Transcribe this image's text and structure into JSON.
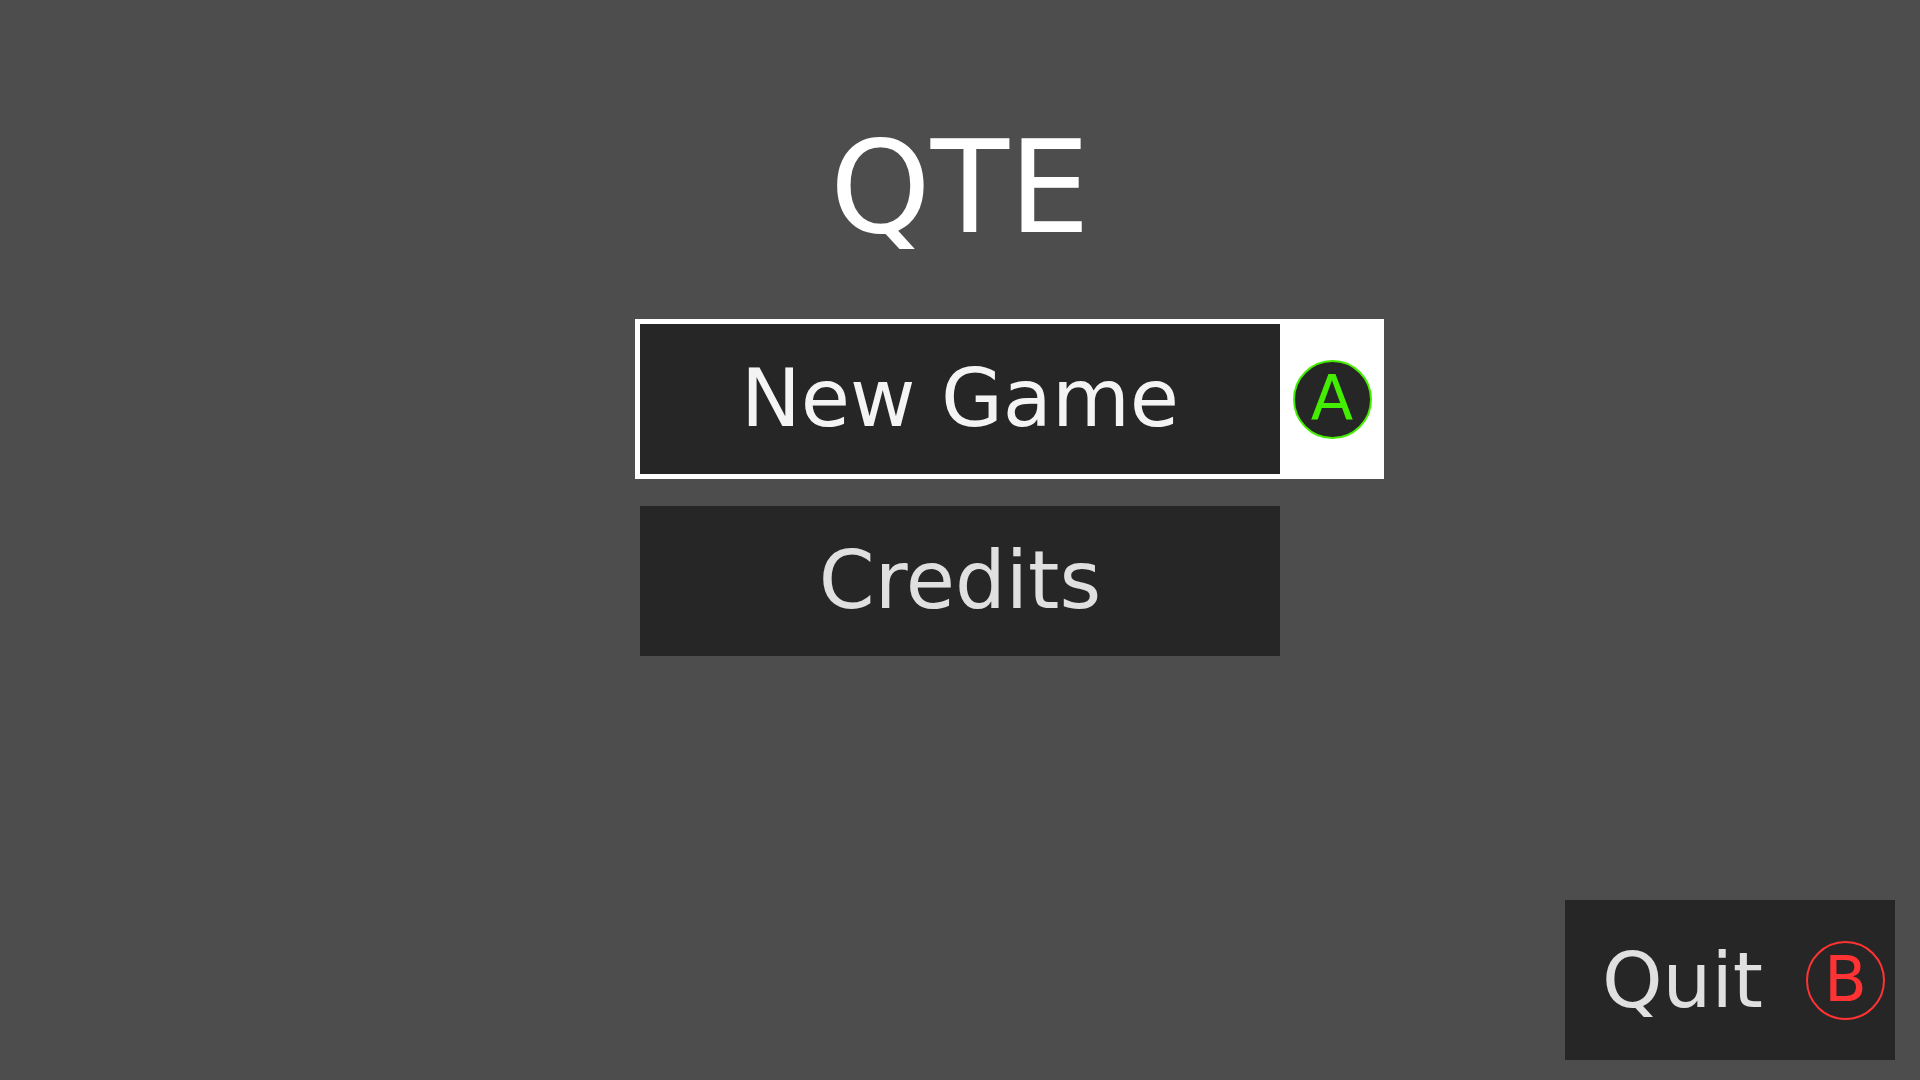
{
  "title": "QTE",
  "menu_items": [
    {
      "label": "New Game",
      "selected": true,
      "prompt": {
        "label": "A",
        "color": "#44ee00"
      }
    },
    {
      "label": "Credits",
      "selected": false
    }
  ],
  "quit_button": {
    "label": "Quit",
    "prompt": {
      "label": "B",
      "color": "#ff3333"
    }
  }
}
